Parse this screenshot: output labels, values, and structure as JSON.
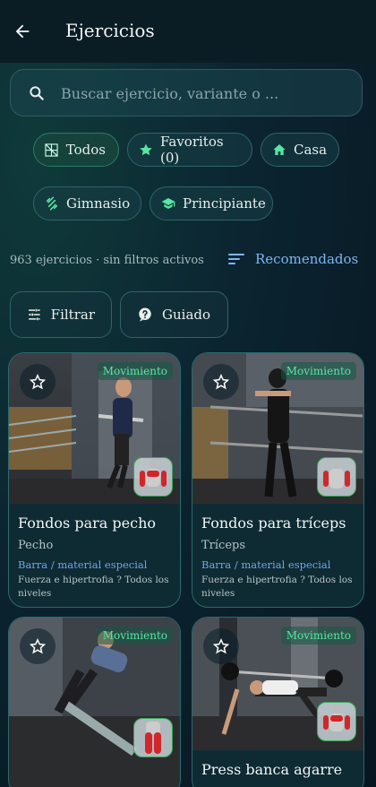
{
  "header": {
    "title": "Ejercicios",
    "back_icon": "arrow-left-icon"
  },
  "search": {
    "placeholder": "Buscar ejercicio, variante o ..."
  },
  "chips": [
    {
      "label": "Todos",
      "icon": "grid-icon",
      "active": true
    },
    {
      "label": "Favoritos (0)",
      "icon": "star-icon",
      "active": false
    },
    {
      "label": "Casa",
      "icon": "home-icon",
      "active": false
    },
    {
      "label": "Gimnasio",
      "icon": "dumbbell-icon",
      "active": false
    },
    {
      "label": "Principiante",
      "icon": "school-icon",
      "active": false
    }
  ],
  "results": {
    "count_text": "963 ejercicios · sin filtros activos",
    "sort_label": "Recomendados"
  },
  "toolbar": {
    "filter_label": "Filtrar",
    "guided_label": "Guiado"
  },
  "cards": [
    {
      "title": "Fondos para pecho",
      "muscle": "Pecho",
      "equipment": "Barra / material especial",
      "description": "Fuerza e hipertrofia ? Todos los niveles",
      "badge": "Movimiento"
    },
    {
      "title": "Fondos para tríceps",
      "muscle": "Tríceps",
      "equipment": "Barra / material especial",
      "description": "Fuerza e hipertrofia ? Todos los niveles",
      "badge": "Movimiento"
    },
    {
      "title": "",
      "muscle": "",
      "equipment": "",
      "description": "",
      "badge": "Movimiento"
    },
    {
      "title": "Press banca agarre",
      "muscle": "",
      "equipment": "",
      "description": "",
      "badge": "Movimiento"
    }
  ],
  "colors": {
    "accent_green": "#58e6a3",
    "accent_blue": "#7fb6f0",
    "background": "#0b2430"
  }
}
